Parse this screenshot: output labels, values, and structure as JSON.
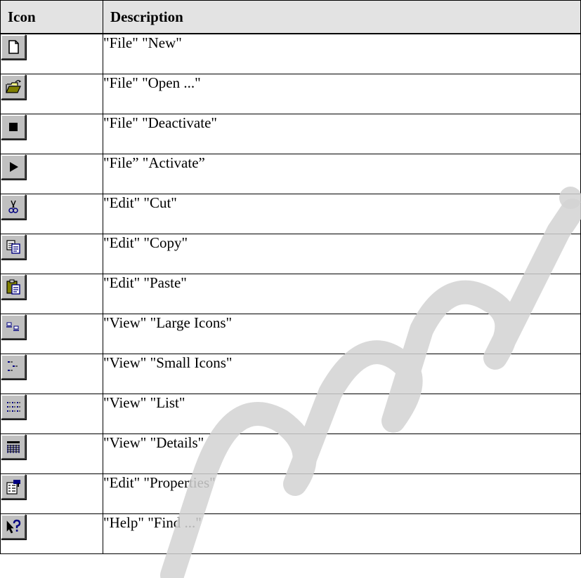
{
  "table": {
    "headers": {
      "icon": "Icon",
      "description": "Description"
    },
    "rows": [
      {
        "icon": "new-file-icon",
        "description": "\"File\" \"New\""
      },
      {
        "icon": "open-folder-icon",
        "description": "\"File\" \"Open ...\""
      },
      {
        "icon": "stop-icon",
        "description": "\"File\" \"Deactivate\""
      },
      {
        "icon": "play-icon",
        "description": "\"File” \"Activate”"
      },
      {
        "icon": "scissors-icon",
        "description": "\"Edit\" \"Cut\""
      },
      {
        "icon": "copy-icon",
        "description": "\"Edit\" \"Copy\""
      },
      {
        "icon": "paste-icon",
        "description": "\"Edit\" \"Paste\""
      },
      {
        "icon": "large-icons-icon",
        "description": "\"View\" \"Large Icons\""
      },
      {
        "icon": "small-icons-icon",
        "description": "\"View\" \"Small Icons\""
      },
      {
        "icon": "list-view-icon",
        "description": "\"View\" \"List\""
      },
      {
        "icon": "details-view-icon",
        "description": "\"View\" \"Details\""
      },
      {
        "icon": "properties-icon",
        "description": "\"Edit\" \"Properties\""
      },
      {
        "icon": "help-find-icon",
        "description": "\"Help\" \"Find ...\""
      }
    ]
  },
  "colors": {
    "header_bg": "#e3e3e3",
    "button_face": "#c0c0c0",
    "icon_blue": "#000080",
    "watermark": "#cfcfcf"
  }
}
